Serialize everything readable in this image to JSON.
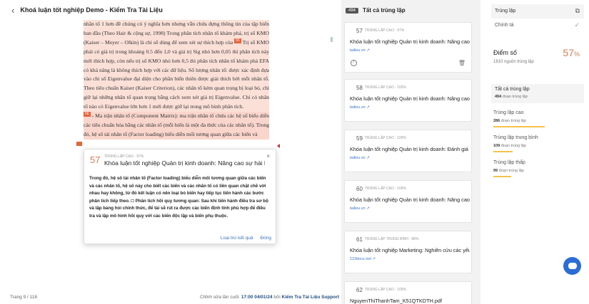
{
  "header": {
    "back_icon": "chevron-left-icon",
    "title": "Khoá luận tốt nghiệp Demo - Kiểm Tra Tài Liệu"
  },
  "document": {
    "lines": [
      "nhân tố 1 hơn đề chúng có ý nghĩa hơn nhưng vẫn chứa đựng thông tin của",
      "tập biến ban đầu (Theo Hair & cộng sự, 1998) Trong phân tích nhân tố khám phá, trị",
      "số KMO (Kaiser – Meyer – Olkin) là chỉ số dùng để xem xét sự thích hợp của",
      "Trị số KMO phải có giá trị trong khoảng 0.5 đến 1,0 và giá trị Sig nhỏ hơn",
      "0,05 thì phân tích này mới thích hợp, còn nếu trị số KMO nhỏ hơn 0,5 thì phân tích",
      "nhân tố khám phá EFA có khả năng là không thích hợp với các dữ liệu. Số lượng",
      "nhân tố: được xác định dựa vào chỉ số Eigenvalue đại diện cho phần biến thiên được",
      "giải thích bởi mỗi nhân tố. Theo tiêu chuẩn Kaiser (Kaiser Criterion), các nhân tố kém",
      "quan trọng bị loại bỏ, chỉ giữ lại những nhân tố quan trọng bằng cách xem xét giá trị",
      "Eigenvalue. Chỉ có nhân tố nào có Eigenvalue lớn hơn 1 mới được giữ lại trong mô",
      "hình phân tích.",
      "- Ma trận nhân tố (Component Matrix): ma trận nhân tố chứa các hệ số biểu",
      "diễn các tiêu chuẩn hóa bằng các nhân tố (mỗi biến là một đa thức của các nhân tố).",
      "Trong đó, hệ số tải nhân tố (Factor loading) biểu diễn mối tương quan giữa các biến và"
    ],
    "marks": [
      "55",
      "56",
      "57",
      "58",
      "59",
      "60",
      "61",
      "62"
    ]
  },
  "popup": {
    "percent": "57",
    "level": "TRÙNG LẶP CAO - 97%",
    "title": "Khóa luận tốt nghiệp Quản trị kinh doanh: Nâng cao sự hài lòng",
    "body": "Trong đó, hệ số tải nhân tố (Factor loading) biểu diễn mối tương quan giữa các biến và các nhân tố, hệ số này cho biết các biến và các nhân tố có liên quan chặt chẽ với nhau hay không, từ đó kết luận có nên loại bỏ biến hay tiếp tục tiến hành các bước phân tích tiếp theo. 🗆 Phân tích hồi quy tương quan: Sau khi tiến hành điều tra sơ bộ và lập bảng hỏi chính thức, để tài sẽ rút ra được các biến định tính phù hợp để điều tra và lập mô hình hồi quy với các biến độc lập và biến phụ thuộc.",
    "close_icon": "close-icon",
    "exclude_label": "Loại trừ kết quả",
    "close_label": "Đóng"
  },
  "footer": {
    "page": "Trang 9 / 118",
    "edited_prefix": "Chỉnh sửa lần cuối:",
    "edited_time": "17:00 04/01/24",
    "by": "bởi",
    "author": "Kiểm Tra Tài Liệu Support"
  },
  "results": {
    "count": "494",
    "header": "Tất cả trùng lặp",
    "items": [
      {
        "num": "57",
        "level": "TRÙNG LẶP CAO - 97%",
        "title": "Khóa luận tốt nghiệp Quản trị kinh doanh: Nâng cao sự hài lòng",
        "source": "tailieu.vn"
      },
      {
        "num": "58",
        "level": "TRÙNG LẶP CAO - 100%",
        "title": "Khóa luận tốt nghiệp Quản trị kinh doanh: Nâng cao sự hài lòng",
        "source": "tailieu.vn"
      },
      {
        "num": "59",
        "level": "TRÙNG LẶP CAO - 100%",
        "title": "Khóa luận tốt nghiệp Quản trị kinh doanh: Đánh giá sự hài lòng",
        "source": "tailieu.vn"
      },
      {
        "num": "60",
        "level": "TRÙNG LẶP CAO - 100%",
        "title": "Khóa luận tốt nghiệp Quản trị kinh doanh: Nâng cao sự hài lòng",
        "source": "tailieu.vn"
      },
      {
        "num": "61",
        "level": "TRÙNG LẶP TRUNG BÌNH - 88%",
        "title": "Khóa luận tốt nghiệp Marketing: Nghiên cứu các yếu tố ảnh",
        "source": "123docz.net"
      },
      {
        "num": "62",
        "level": "TRÙNG LẶP CAO - 100%",
        "title": "NguyenThiThanhTam_K51QTKDTH.pdf",
        "source": ""
      }
    ]
  },
  "sidebar": {
    "tab_duplicate": "Trùng lặp",
    "tab_spelling": "Chính tả",
    "score_label": "Điểm số",
    "score_value": "57",
    "score_unit": "%",
    "score_sub": "1810 nguồn trùng lặp",
    "all_label": "Tất cả trùng lặp",
    "all_count": "494",
    "all_unit": "đoạn trùng lặp",
    "stats": [
      {
        "label": "Trùng lặp cao",
        "count": "286",
        "unit": "đoạn trùng lặp",
        "fill": 0.58
      },
      {
        "label": "Trùng lặp trung bình",
        "count": "109",
        "unit": "đoạn trùng lặp",
        "fill": 0.22
      },
      {
        "label": "Trùng lặp thấp",
        "count": "99",
        "unit": "đoạn trùng lặp",
        "fill": 0.2
      }
    ],
    "colors": {
      "accent": "#e07b55",
      "link": "#3a74d0",
      "bar": "#f3c34c",
      "highlight": "#fbe0d8"
    }
  }
}
